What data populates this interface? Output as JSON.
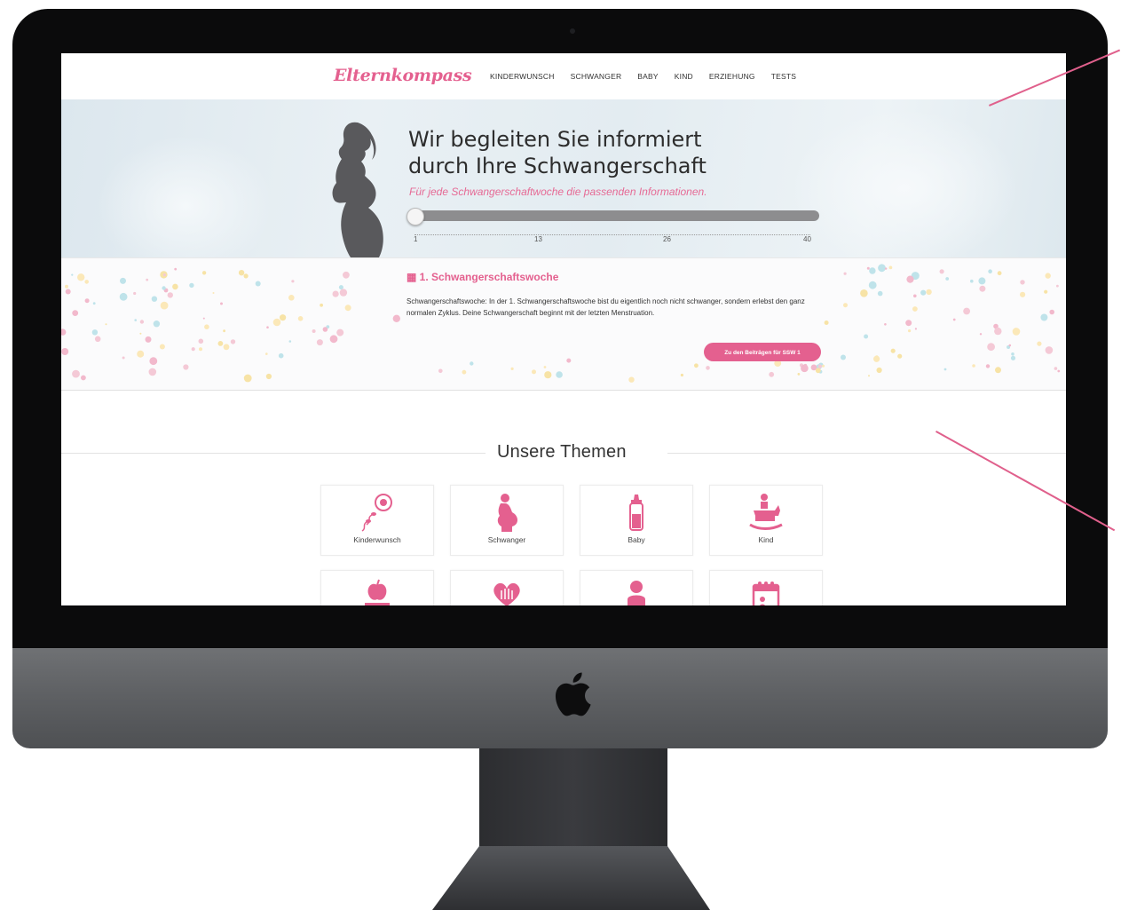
{
  "nav": {
    "logo": "Elternkompass",
    "items": [
      "KINDERWUNSCH",
      "SCHWANGER",
      "BABY",
      "KIND",
      "ERZIEHUNG",
      "TESTS"
    ]
  },
  "hero": {
    "title_line1": "Wir begleiten Sie informiert",
    "title_line2": "durch Ihre Schwangerschaft",
    "subtitle": "Für jede Schwangerschaftwoche die passenden Informationen.",
    "slider": {
      "min": 1,
      "max": 40,
      "value": 1,
      "ticks": [
        "1",
        "13",
        "26",
        "40"
      ]
    }
  },
  "week": {
    "title": "1. Schwangerschaftswoche",
    "text": "Schwangerschaftswoche: In der 1. Schwangerschaftswoche bist du eigentlich noch nicht schwanger, sondern erlebst den ganz normalen Zyklus. Deine Schwangerschaft beginnt mit der letzten Menstruation.",
    "button": "Zu den Beiträgen für SSW 1"
  },
  "themes": {
    "heading": "Unsere Themen",
    "cards": [
      {
        "label": "Kinderwunsch",
        "icon": "sperm-egg-icon"
      },
      {
        "label": "Schwanger",
        "icon": "pregnant-icon"
      },
      {
        "label": "Baby",
        "icon": "baby-bottle-icon"
      },
      {
        "label": "Kind",
        "icon": "rocking-horse-icon"
      },
      {
        "label": "",
        "icon": "apple-books-icon"
      },
      {
        "label": "",
        "icon": "heart-hands-icon"
      },
      {
        "label": "",
        "icon": "child-icon"
      },
      {
        "label": "",
        "icon": "calendar-icon"
      }
    ]
  },
  "colors": {
    "accent": "#e4608f",
    "text": "#333333",
    "bezel": "#0b0b0c",
    "chin": "#5f6164"
  }
}
